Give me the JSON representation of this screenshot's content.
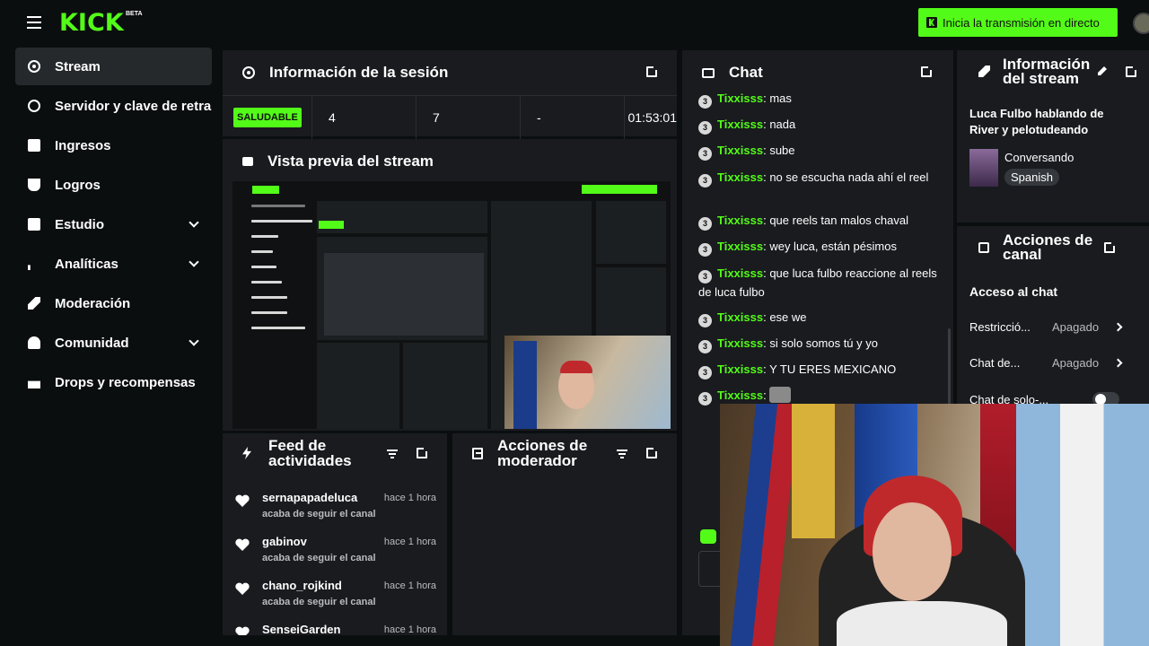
{
  "topbar": {
    "logo": "KICK",
    "logo_badge": "BETA",
    "go_live_label": "Inicia la transmisión en directo"
  },
  "sidebar": {
    "items": [
      {
        "label": "Stream",
        "icon": "stream-icon",
        "active": true
      },
      {
        "label": "Servidor y clave de retransmisión",
        "icon": "link-icon"
      },
      {
        "label": "Ingresos",
        "icon": "revenue-icon"
      },
      {
        "label": "Logros",
        "icon": "trophy-icon"
      },
      {
        "label": "Estudio",
        "icon": "studio-icon",
        "expandable": true
      },
      {
        "label": "Analíticas",
        "icon": "analytics-icon",
        "expandable": true
      },
      {
        "label": "Moderación",
        "icon": "wrench-icon"
      },
      {
        "label": "Comunidad",
        "icon": "community-icon",
        "expandable": true
      },
      {
        "label": "Drops y recompensas",
        "icon": "gift-icon"
      }
    ]
  },
  "session": {
    "title": "Información de la sesión",
    "status": "SALUDABLE",
    "viewers": "4",
    "followers": "7",
    "subs": "-",
    "duration": "01:53:01"
  },
  "preview": {
    "title": "Vista previa del stream"
  },
  "feed": {
    "title_line1": "Feed de",
    "title_line2": "actividades",
    "items": [
      {
        "name": "sernapapadeluca",
        "time": "hace 1 hora",
        "action": "acaba de seguir el canal"
      },
      {
        "name": "gabinov",
        "time": "hace 1 hora",
        "action": "acaba de seguir el canal"
      },
      {
        "name": "chano_rojkind",
        "time": "hace 1 hora",
        "action": "acaba de seguir el canal"
      },
      {
        "name": "SenseiGarden",
        "time": "hace 1 hora",
        "action": ""
      }
    ]
  },
  "mod_actions": {
    "title_line1": "Acciones de",
    "title_line2": "moderador"
  },
  "chat": {
    "title": "Chat",
    "badge": "3",
    "messages": [
      {
        "user": "Tixxisss",
        "text": "mas"
      },
      {
        "user": "Tixxisss",
        "text": "nada"
      },
      {
        "user": "Tixxisss",
        "text": "sube"
      },
      {
        "user": "Tixxisss",
        "text": "no se escucha nada ahí el reel"
      },
      {
        "user": "Tixxisss",
        "text": "que reels tan malos chaval"
      },
      {
        "user": "Tixxisss",
        "text": "wey luca, están pésimos"
      },
      {
        "user": "Tixxisss",
        "text": "que luca fulbo reaccione al reels de luca fulbo"
      },
      {
        "user": "Tixxisss",
        "text": "ese we"
      },
      {
        "user": "Tixxisss",
        "text": "si solo somos tú y yo"
      },
      {
        "user": "Tixxisss",
        "text": "Y TU ERES MEXICANO"
      },
      {
        "user": "Tixxisss",
        "text": ""
      }
    ]
  },
  "stream_info": {
    "title_line1": "Información",
    "title_line2": "del stream",
    "stream_title": "Luca Fulbo hablando de River y pelotudeando",
    "category": "Conversando",
    "language": "Spanish"
  },
  "channel_actions": {
    "title_line1": "Acciones de",
    "title_line2": "canal",
    "section": "Acceso al chat",
    "rows": [
      {
        "label": "Restricció...",
        "value": "Apagado"
      },
      {
        "label": "Chat de...",
        "value": "Apagado"
      },
      {
        "label": "Chat de solo-...",
        "value": ""
      }
    ]
  },
  "colors": {
    "accent": "#53fc18",
    "panel": "#191b1f",
    "background": "#0b0e0f"
  }
}
